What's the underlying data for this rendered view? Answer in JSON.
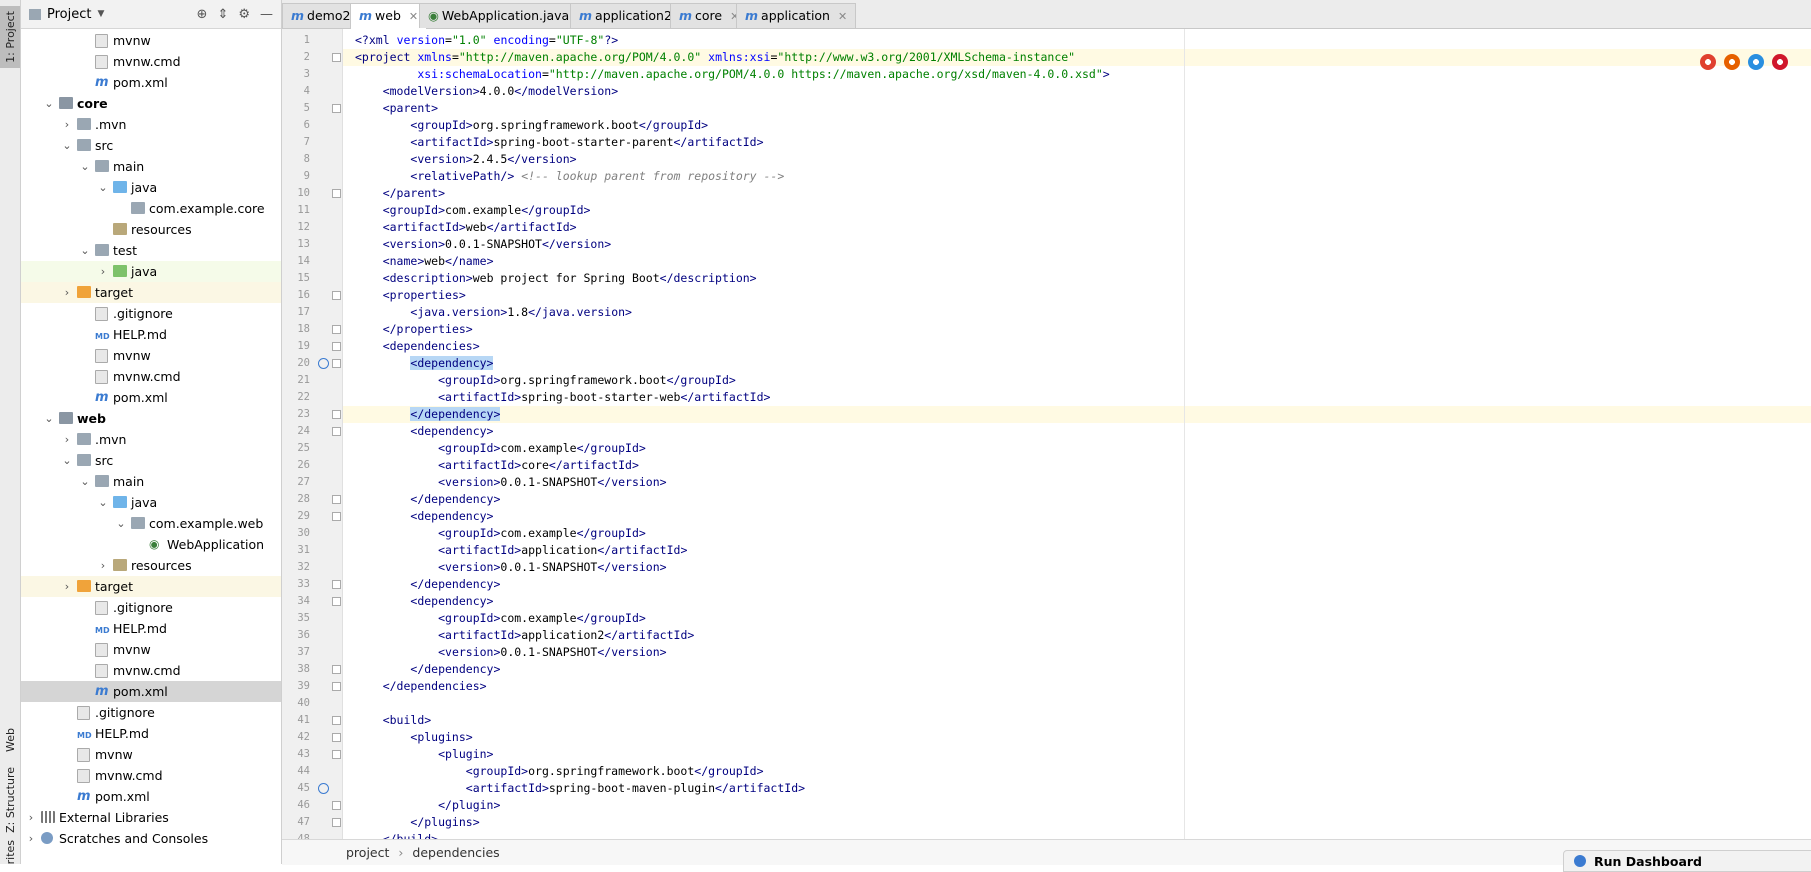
{
  "left_strip": {
    "tabs": [
      {
        "label": "1: Project",
        "active": true
      },
      {
        "label": "Web"
      },
      {
        "label": "Z: Structure"
      },
      {
        "label": "rites"
      }
    ]
  },
  "project_panel": {
    "title": "Project",
    "tree": [
      {
        "indent": 3,
        "icon": "file",
        "label": "mvnw"
      },
      {
        "indent": 3,
        "icon": "file",
        "label": "mvnw.cmd"
      },
      {
        "indent": 3,
        "icon": "maven",
        "label": "pom.xml"
      },
      {
        "indent": 1,
        "arrow": "down",
        "icon": "module",
        "label": "core",
        "bold": true
      },
      {
        "indent": 2,
        "arrow": "right",
        "icon": "folder",
        "label": ".mvn"
      },
      {
        "indent": 2,
        "arrow": "down",
        "icon": "folder",
        "label": "src"
      },
      {
        "indent": 3,
        "arrow": "down",
        "icon": "folder",
        "label": "main"
      },
      {
        "indent": 4,
        "arrow": "down",
        "icon": "folder-blue",
        "label": "java"
      },
      {
        "indent": 5,
        "icon": "folder",
        "label": "com.example.core"
      },
      {
        "indent": 4,
        "icon": "folder-res",
        "label": "resources"
      },
      {
        "indent": 3,
        "arrow": "down",
        "icon": "folder",
        "label": "test"
      },
      {
        "indent": 4,
        "arrow": "right",
        "icon": "folder-green",
        "label": "java",
        "hl": "green"
      },
      {
        "indent": 2,
        "arrow": "right",
        "icon": "folder-orange",
        "label": "target",
        "hl": "yellow"
      },
      {
        "indent": 3,
        "icon": "file",
        "label": ".gitignore"
      },
      {
        "indent": 3,
        "icon": "md",
        "label": "HELP.md"
      },
      {
        "indent": 3,
        "icon": "file",
        "label": "mvnw"
      },
      {
        "indent": 3,
        "icon": "file",
        "label": "mvnw.cmd"
      },
      {
        "indent": 3,
        "icon": "maven",
        "label": "pom.xml"
      },
      {
        "indent": 1,
        "arrow": "down",
        "icon": "module",
        "label": "web",
        "bold": true
      },
      {
        "indent": 2,
        "arrow": "right",
        "icon": "folder",
        "label": ".mvn"
      },
      {
        "indent": 2,
        "arrow": "down",
        "icon": "folder",
        "label": "src"
      },
      {
        "indent": 3,
        "arrow": "down",
        "icon": "folder",
        "label": "main"
      },
      {
        "indent": 4,
        "arrow": "down",
        "icon": "folder-blue",
        "label": "java"
      },
      {
        "indent": 5,
        "arrow": "down",
        "icon": "folder",
        "label": "com.example.web"
      },
      {
        "indent": 6,
        "icon": "java",
        "label": "WebApplication"
      },
      {
        "indent": 4,
        "arrow": "right",
        "icon": "folder-res",
        "label": "resources"
      },
      {
        "indent": 2,
        "arrow": "right",
        "icon": "folder-orange",
        "label": "target",
        "hl": "yellow"
      },
      {
        "indent": 3,
        "icon": "file",
        "label": ".gitignore"
      },
      {
        "indent": 3,
        "icon": "md",
        "label": "HELP.md"
      },
      {
        "indent": 3,
        "icon": "file",
        "label": "mvnw"
      },
      {
        "indent": 3,
        "icon": "file",
        "label": "mvnw.cmd"
      },
      {
        "indent": 3,
        "icon": "maven",
        "label": "pom.xml",
        "selected": true
      },
      {
        "indent": 2,
        "icon": "file",
        "label": ".gitignore"
      },
      {
        "indent": 2,
        "icon": "md",
        "label": "HELP.md"
      },
      {
        "indent": 2,
        "icon": "file",
        "label": "mvnw"
      },
      {
        "indent": 2,
        "icon": "file",
        "label": "mvnw.cmd"
      },
      {
        "indent": 2,
        "icon": "maven",
        "label": "pom.xml"
      },
      {
        "indent": 0,
        "arrow": "right",
        "icon": "library",
        "label": "External Libraries"
      },
      {
        "indent": 0,
        "arrow": "right",
        "icon": "scratch",
        "label": "Scratches and Consoles"
      }
    ]
  },
  "tabs": [
    {
      "label": "demo2",
      "type": "maven"
    },
    {
      "label": "web",
      "type": "maven",
      "active": true
    },
    {
      "label": "WebApplication.java",
      "type": "java"
    },
    {
      "label": "application2",
      "type": "maven"
    },
    {
      "label": "core",
      "type": "maven"
    },
    {
      "label": "application",
      "type": "maven"
    }
  ],
  "editor": {
    "lines": [
      [
        [
          "t",
          "<?"
        ],
        [
          "t",
          "xml "
        ],
        [
          "an",
          "version"
        ],
        [
          "tx",
          "="
        ],
        [
          "av",
          "\"1.0\""
        ],
        [
          "tx",
          " "
        ],
        [
          "an",
          "encoding"
        ],
        [
          "tx",
          "="
        ],
        [
          "av",
          "\"UTF-8\""
        ],
        [
          "t",
          "?>"
        ]
      ],
      [
        [
          "t",
          "<project "
        ],
        [
          "an",
          "xmlns"
        ],
        [
          "tx",
          "="
        ],
        [
          "av",
          "\"http://maven.apache.org/POM/4.0.0\""
        ],
        [
          "tx",
          " "
        ],
        [
          "an",
          "xmlns:xsi"
        ],
        [
          "tx",
          "="
        ],
        [
          "av",
          "\"http://www.w3.org/2001/XMLSchema-instance\""
        ]
      ],
      [
        [
          "tx",
          "         "
        ],
        [
          "an",
          "xsi:schemaLocation"
        ],
        [
          "tx",
          "="
        ],
        [
          "av",
          "\"http://maven.apache.org/POM/4.0.0 https://maven.apache.org/xsd/maven-4.0.0.xsd\""
        ],
        [
          "t",
          ">"
        ]
      ],
      [
        [
          "tx",
          "    "
        ],
        [
          "t",
          "<modelVersion>"
        ],
        [
          "tx",
          "4.0.0"
        ],
        [
          "t",
          "</modelVersion>"
        ]
      ],
      [
        [
          "tx",
          "    "
        ],
        [
          "t",
          "<parent>"
        ]
      ],
      [
        [
          "tx",
          "        "
        ],
        [
          "t",
          "<groupId>"
        ],
        [
          "tx",
          "org.springframework.boot"
        ],
        [
          "t",
          "</groupId>"
        ]
      ],
      [
        [
          "tx",
          "        "
        ],
        [
          "t",
          "<artifactId>"
        ],
        [
          "tx",
          "spring-boot-starter-parent"
        ],
        [
          "t",
          "</artifactId>"
        ]
      ],
      [
        [
          "tx",
          "        "
        ],
        [
          "t",
          "<version>"
        ],
        [
          "tx",
          "2.4.5"
        ],
        [
          "t",
          "</version>"
        ]
      ],
      [
        [
          "tx",
          "        "
        ],
        [
          "t",
          "<relativePath/>"
        ],
        [
          "tx",
          " "
        ],
        [
          "cm",
          "<!-- lookup parent from repository -->"
        ]
      ],
      [
        [
          "tx",
          "    "
        ],
        [
          "t",
          "</parent>"
        ]
      ],
      [
        [
          "tx",
          "    "
        ],
        [
          "t",
          "<groupId>"
        ],
        [
          "tx",
          "com.example"
        ],
        [
          "t",
          "</groupId>"
        ]
      ],
      [
        [
          "tx",
          "    "
        ],
        [
          "t",
          "<artifactId>"
        ],
        [
          "tx",
          "web"
        ],
        [
          "t",
          "</artifactId>"
        ]
      ],
      [
        [
          "tx",
          "    "
        ],
        [
          "t",
          "<version>"
        ],
        [
          "tx",
          "0.0.1-SNAPSHOT"
        ],
        [
          "t",
          "</version>"
        ]
      ],
      [
        [
          "tx",
          "    "
        ],
        [
          "t",
          "<name>"
        ],
        [
          "tx",
          "web"
        ],
        [
          "t",
          "</name>"
        ]
      ],
      [
        [
          "tx",
          "    "
        ],
        [
          "t",
          "<description>"
        ],
        [
          "tx",
          "web project for Spring Boot"
        ],
        [
          "t",
          "</description>"
        ]
      ],
      [
        [
          "tx",
          "    "
        ],
        [
          "t",
          "<properties>"
        ]
      ],
      [
        [
          "tx",
          "        "
        ],
        [
          "t",
          "<java.version>"
        ],
        [
          "tx",
          "1.8"
        ],
        [
          "t",
          "</java.version>"
        ]
      ],
      [
        [
          "tx",
          "    "
        ],
        [
          "t",
          "</properties>"
        ]
      ],
      [
        [
          "tx",
          "    "
        ],
        [
          "t",
          "<dependencies>"
        ]
      ],
      [
        [
          "tx",
          "        "
        ],
        [
          "sel",
          "<dependency>"
        ]
      ],
      [
        [
          "tx",
          "            "
        ],
        [
          "t",
          "<groupId>"
        ],
        [
          "tx",
          "org.springframework.boot"
        ],
        [
          "t",
          "</groupId>"
        ]
      ],
      [
        [
          "tx",
          "            "
        ],
        [
          "t",
          "<artifactId>"
        ],
        [
          "tx",
          "spring-boot-starter-web"
        ],
        [
          "t",
          "</artifactId>"
        ]
      ],
      [
        [
          "tx",
          "        "
        ],
        [
          "sel",
          "</dependency>"
        ]
      ],
      [
        [
          "tx",
          "        "
        ],
        [
          "t",
          "<dependency>"
        ]
      ],
      [
        [
          "tx",
          "            "
        ],
        [
          "t",
          "<groupId>"
        ],
        [
          "tx",
          "com.example"
        ],
        [
          "t",
          "</groupId>"
        ]
      ],
      [
        [
          "tx",
          "            "
        ],
        [
          "t",
          "<artifactId>"
        ],
        [
          "tx",
          "core"
        ],
        [
          "t",
          "</artifactId>"
        ]
      ],
      [
        [
          "tx",
          "            "
        ],
        [
          "t",
          "<version>"
        ],
        [
          "tx",
          "0.0.1-SNAPSHOT"
        ],
        [
          "t",
          "</version>"
        ]
      ],
      [
        [
          "tx",
          "        "
        ],
        [
          "t",
          "</dependency>"
        ]
      ],
      [
        [
          "tx",
          "        "
        ],
        [
          "t",
          "<dependency>"
        ]
      ],
      [
        [
          "tx",
          "            "
        ],
        [
          "t",
          "<groupId>"
        ],
        [
          "tx",
          "com.example"
        ],
        [
          "t",
          "</groupId>"
        ]
      ],
      [
        [
          "tx",
          "            "
        ],
        [
          "t",
          "<artifactId>"
        ],
        [
          "tx",
          "application"
        ],
        [
          "t",
          "</artifactId>"
        ]
      ],
      [
        [
          "tx",
          "            "
        ],
        [
          "t",
          "<version>"
        ],
        [
          "tx",
          "0.0.1-SNAPSHOT"
        ],
        [
          "t",
          "</version>"
        ]
      ],
      [
        [
          "tx",
          "        "
        ],
        [
          "t",
          "</dependency>"
        ]
      ],
      [
        [
          "tx",
          "        "
        ],
        [
          "t",
          "<dependency>"
        ]
      ],
      [
        [
          "tx",
          "            "
        ],
        [
          "t",
          "<groupId>"
        ],
        [
          "tx",
          "com.example"
        ],
        [
          "t",
          "</groupId>"
        ]
      ],
      [
        [
          "tx",
          "            "
        ],
        [
          "t",
          "<artifactId>"
        ],
        [
          "tx",
          "application2"
        ],
        [
          "t",
          "</artifactId>"
        ]
      ],
      [
        [
          "tx",
          "            "
        ],
        [
          "t",
          "<version>"
        ],
        [
          "tx",
          "0.0.1-SNAPSHOT"
        ],
        [
          "t",
          "</version>"
        ]
      ],
      [
        [
          "tx",
          "        "
        ],
        [
          "t",
          "</dependency>"
        ]
      ],
      [
        [
          "tx",
          "    "
        ],
        [
          "t",
          "</dependencies>"
        ]
      ],
      [],
      [
        [
          "tx",
          "    "
        ],
        [
          "t",
          "<build>"
        ]
      ],
      [
        [
          "tx",
          "        "
        ],
        [
          "t",
          "<plugins>"
        ]
      ],
      [
        [
          "tx",
          "            "
        ],
        [
          "t",
          "<plugin>"
        ]
      ],
      [
        [
          "tx",
          "                "
        ],
        [
          "t",
          "<groupId>"
        ],
        [
          "tx",
          "org.springframework.boot"
        ],
        [
          "t",
          "</groupId>"
        ]
      ],
      [
        [
          "tx",
          "                "
        ],
        [
          "t",
          "<artifactId>"
        ],
        [
          "tx",
          "spring-boot-maven-plugin"
        ],
        [
          "t",
          "</artifactId>"
        ]
      ],
      [
        [
          "tx",
          "            "
        ],
        [
          "t",
          "</plugin>"
        ]
      ],
      [
        [
          "tx",
          "        "
        ],
        [
          "t",
          "</plugins>"
        ]
      ],
      [
        [
          "tx",
          "    "
        ],
        [
          "t",
          "</build>"
        ]
      ]
    ],
    "highlighted_lines": [
      2,
      23
    ],
    "fold_lines": [
      2,
      5,
      10,
      16,
      18,
      19,
      20,
      23,
      24,
      28,
      29,
      33,
      34,
      38,
      39,
      41,
      42,
      43,
      46,
      47
    ],
    "gutter_icon_lines": [
      20,
      45
    ]
  },
  "breadcrumb": [
    "project",
    "dependencies"
  ],
  "run_dashboard": {
    "label": "Run Dashboard"
  },
  "browser_icons": [
    {
      "name": "chrome-icon",
      "color": "#e0402f"
    },
    {
      "name": "firefox-icon",
      "color": "#e66000"
    },
    {
      "name": "safari-icon",
      "color": "#2a8fe0"
    },
    {
      "name": "opera-icon",
      "color": "#d0172b"
    }
  ]
}
